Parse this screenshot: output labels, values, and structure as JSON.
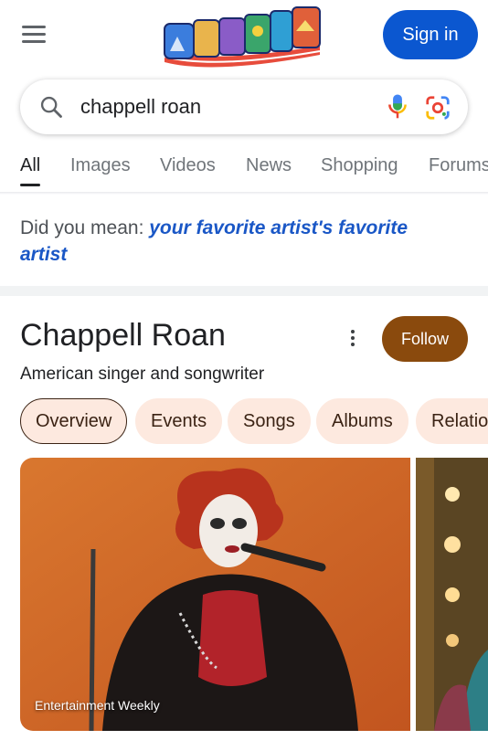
{
  "header": {
    "sign_in_label": "Sign in"
  },
  "search": {
    "query": "chappell roan"
  },
  "tabs": [
    {
      "label": "All"
    },
    {
      "label": "Images"
    },
    {
      "label": "Videos"
    },
    {
      "label": "News"
    },
    {
      "label": "Shopping"
    },
    {
      "label": "Forums"
    }
  ],
  "did_you_mean": {
    "prefix": "Did you mean: ",
    "suggestion": "your favorite artist's favorite artist"
  },
  "knowledge_panel": {
    "title": "Chappell Roan",
    "subtitle": "American singer and songwriter",
    "follow_label": "Follow",
    "accent_color": "#8a4a0d",
    "chips": [
      {
        "label": "Overview"
      },
      {
        "label": "Events"
      },
      {
        "label": "Songs"
      },
      {
        "label": "Albums"
      },
      {
        "label": "Relationships"
      }
    ],
    "images": [
      {
        "caption": "Entertainment Weekly"
      }
    ]
  },
  "icons": {
    "menu": "hamburger-menu-icon",
    "search": "search-icon",
    "voice": "microphone-icon",
    "lens": "google-lens-icon",
    "more": "more-vert-icon"
  },
  "colors": {
    "sign_in_bg": "#0b57d0",
    "link": "#1a57c6",
    "chip_bg": "#fde9df"
  }
}
